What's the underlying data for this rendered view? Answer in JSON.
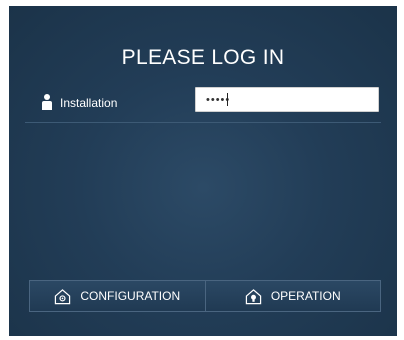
{
  "login": {
    "title": "PLEASE LOG IN",
    "user_label": "Installation",
    "password_value": "•••••"
  },
  "buttons": {
    "configuration_label": "CONFIGURATION",
    "operation_label": "OPERATION"
  },
  "icons": {
    "user": "user-icon",
    "configuration": "house-gear-icon",
    "operation": "house-bulb-icon"
  },
  "colors": {
    "panel_bg": "#223d57",
    "text": "#ffffff",
    "divider": "#3d5a75"
  }
}
